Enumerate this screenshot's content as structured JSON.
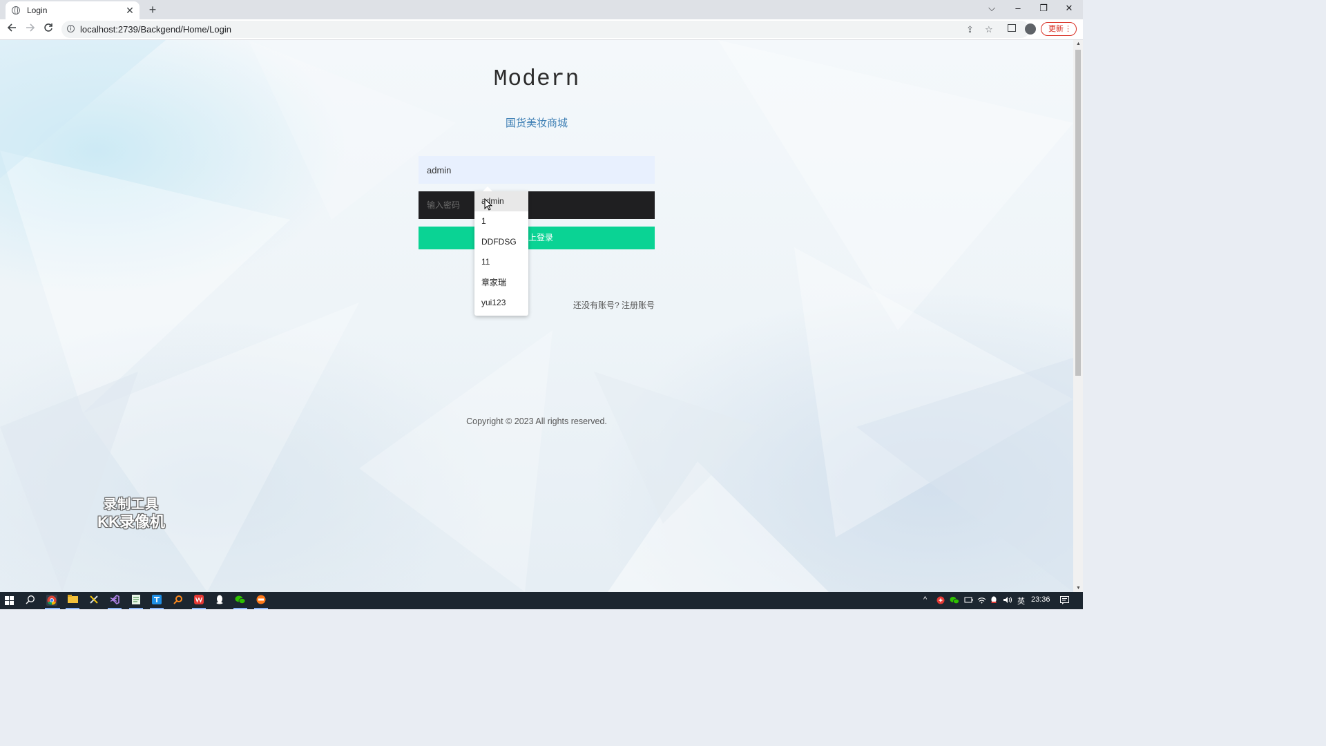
{
  "browser": {
    "tab_title": "Login",
    "tab_close": "✕",
    "new_tab": "+",
    "url": "localhost:2739/Backgend/Home/Login",
    "update_label": "更新",
    "window_controls": {
      "tab_search": "⌵",
      "minimize": "–",
      "restore": "❐",
      "close": "✕"
    }
  },
  "page": {
    "logo": "Modern",
    "subtitle": "国货美妆商城",
    "username_value": "admin",
    "password_placeholder": "输入密码",
    "login_button_label": "马上登录",
    "login_button_visible": "上登录",
    "register_prompt": "还没有账号? 注册账号",
    "copyright": "Copyright © 2023 All rights reserved."
  },
  "autocomplete": {
    "items": [
      "admin",
      "1",
      "DDFDSG",
      "11",
      "章家瑞",
      "yui123"
    ],
    "highlighted_index": 0
  },
  "watermark": {
    "line1": "录制工具",
    "line2": "KK录像机"
  },
  "taskbar": {
    "tray": {
      "ime": "英",
      "time": "23:36"
    }
  },
  "colors": {
    "login_button": "#0ad394",
    "password_field": "#1f1f21",
    "username_field": "#e8f0fe",
    "subtitle": "#3d7fb4",
    "update_button": "#d93025"
  }
}
